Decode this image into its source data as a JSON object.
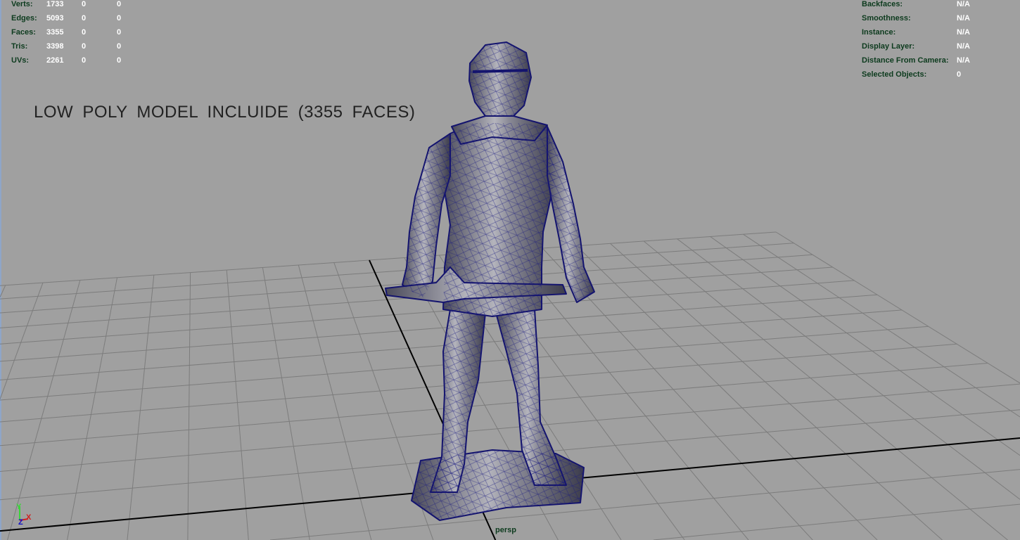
{
  "stats": {
    "rows": [
      {
        "label": "Verts:",
        "values": [
          "1733",
          "0",
          "0"
        ]
      },
      {
        "label": "Edges:",
        "values": [
          "5093",
          "0",
          "0"
        ]
      },
      {
        "label": "Faces:",
        "values": [
          "3355",
          "0",
          "0"
        ]
      },
      {
        "label": "Tris:",
        "values": [
          "3398",
          "0",
          "0"
        ]
      },
      {
        "label": "UVs:",
        "values": [
          "2261",
          "0",
          "0"
        ]
      }
    ]
  },
  "object_info": {
    "rows": [
      {
        "label": "Backfaces:",
        "value": "N/A"
      },
      {
        "label": "Smoothness:",
        "value": "N/A"
      },
      {
        "label": "Instance:",
        "value": "N/A"
      },
      {
        "label": "Display Layer:",
        "value": "N/A"
      },
      {
        "label": "Distance From Camera:",
        "value": "N/A"
      },
      {
        "label": "Selected Objects:",
        "value": "0"
      }
    ]
  },
  "caption": "LOW POLY MODEL INCLUIDE (3355 FACES)",
  "camera_label": "persp",
  "axis_gizmo": {
    "y": "Y",
    "z": "Z",
    "x": "X"
  },
  "colors": {
    "background": "#a0a0a0",
    "grid": "#7c7c7c",
    "axis": "#000000",
    "wireframe": "#14146e",
    "hud_label": "#0d3b1e"
  }
}
